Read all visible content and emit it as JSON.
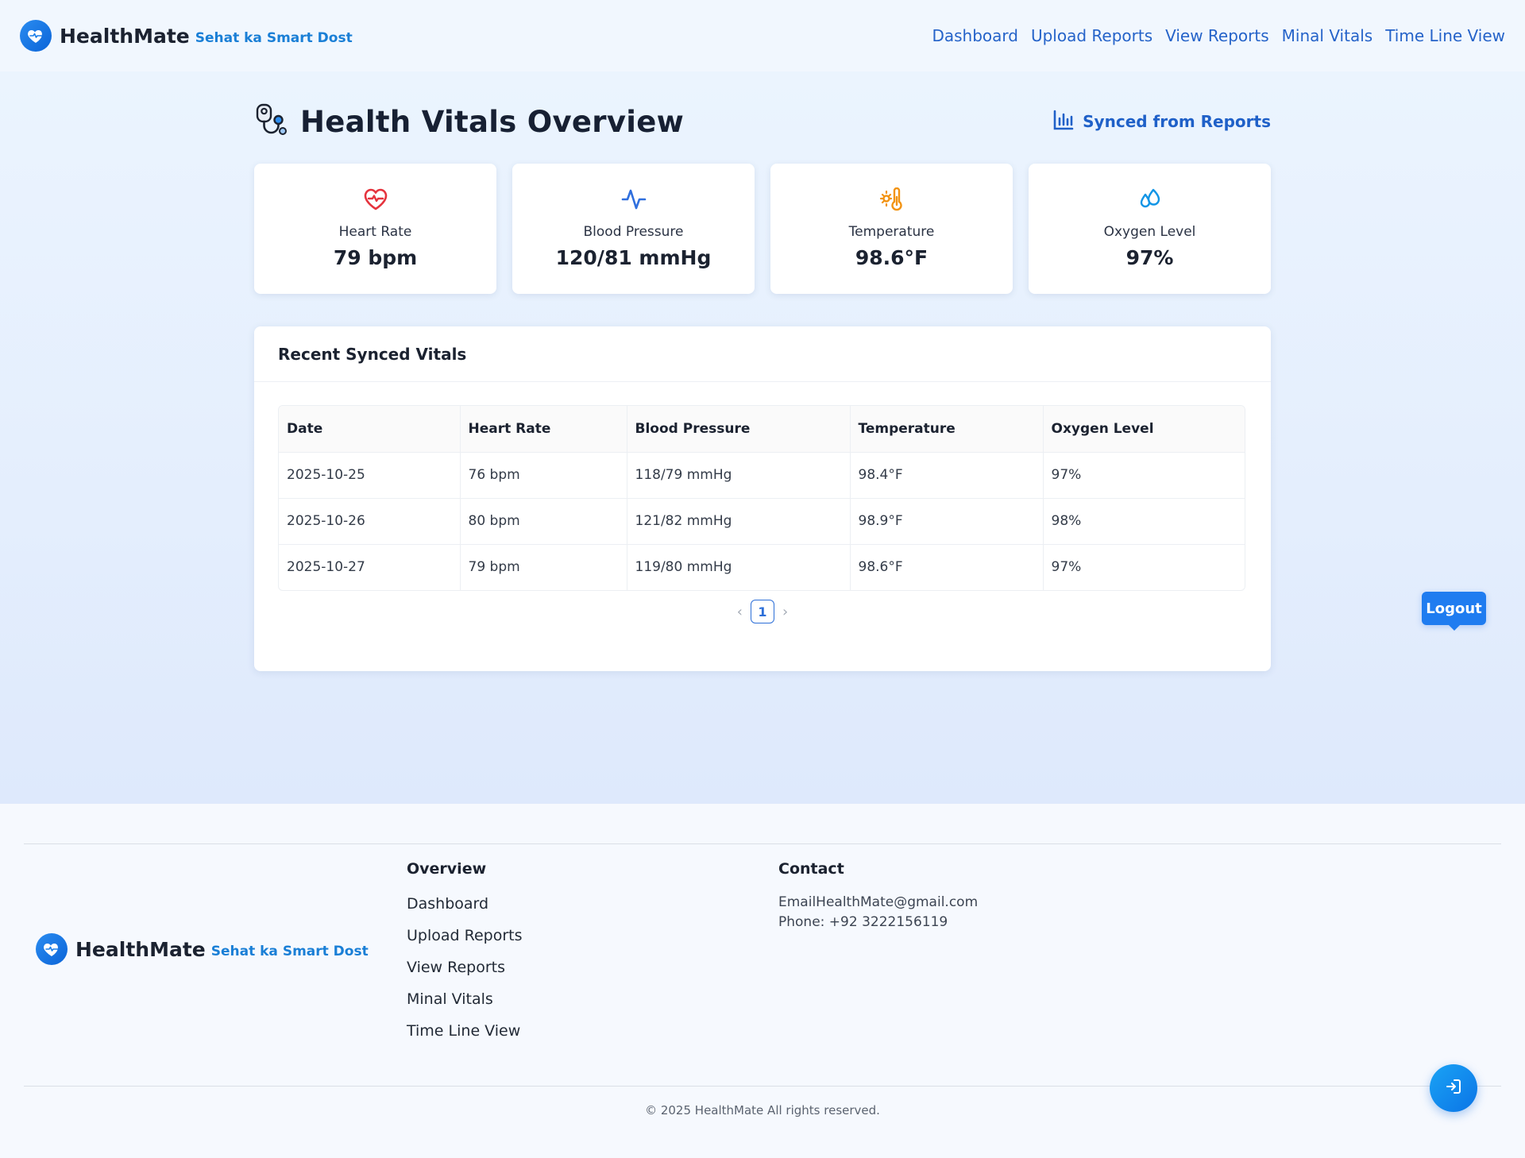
{
  "brand": {
    "name": "HealthMate",
    "tagline": "Sehat ka Smart Dost"
  },
  "nav": {
    "items": [
      {
        "label": "Dashboard"
      },
      {
        "label": "Upload Reports"
      },
      {
        "label": "View Reports"
      },
      {
        "label": "Minal Vitals"
      },
      {
        "label": "Time Line View"
      }
    ]
  },
  "main": {
    "title": "Health Vitals Overview",
    "title_icon": "stethoscope-icon",
    "synced_label": "Synced from Reports",
    "synced_icon": "bar-chart-icon"
  },
  "cards": [
    {
      "label": "Heart Rate",
      "value": "79 bpm",
      "icon": "heart-pulse-icon",
      "color": "#e5333d"
    },
    {
      "label": "Blood Pressure",
      "value": "120/81 mmHg",
      "icon": "activity-icon",
      "color": "#2f6fde"
    },
    {
      "label": "Temperature",
      "value": "98.6°F",
      "icon": "thermometer-sun-icon",
      "color": "#f29312"
    },
    {
      "label": "Oxygen Level",
      "value": "97%",
      "icon": "droplets-icon",
      "color": "#1295e6"
    }
  ],
  "table": {
    "title": "Recent Synced Vitals",
    "columns": [
      "Date",
      "Heart Rate",
      "Blood Pressure",
      "Temperature",
      "Oxygen Level"
    ],
    "rows": [
      [
        "2025-10-25",
        "76 bpm",
        "118/79 mmHg",
        "98.4°F",
        "97%"
      ],
      [
        "2025-10-26",
        "80 bpm",
        "121/82 mmHg",
        "98.9°F",
        "98%"
      ],
      [
        "2025-10-27",
        "79 bpm",
        "119/80 mmHg",
        "98.6°F",
        "97%"
      ]
    ]
  },
  "pagination": {
    "prev": "‹",
    "current": "1",
    "next": "›"
  },
  "logout": {
    "label": "Logout"
  },
  "footer": {
    "overview_title": "Overview",
    "links": [
      {
        "label": "Dashboard"
      },
      {
        "label": "Upload Reports"
      },
      {
        "label": "View Reports"
      },
      {
        "label": "Minal Vitals"
      },
      {
        "label": "Time Line View"
      }
    ],
    "contact_title": "Contact",
    "email": "EmailHealthMate@gmail.com",
    "phone": "Phone: +92 3222156119",
    "copyright": "© 2025 HealthMate All rights reserved."
  },
  "colors": {
    "accent": "#1f7cf0",
    "link": "#2563c9",
    "tagline": "#1a7fd6"
  }
}
